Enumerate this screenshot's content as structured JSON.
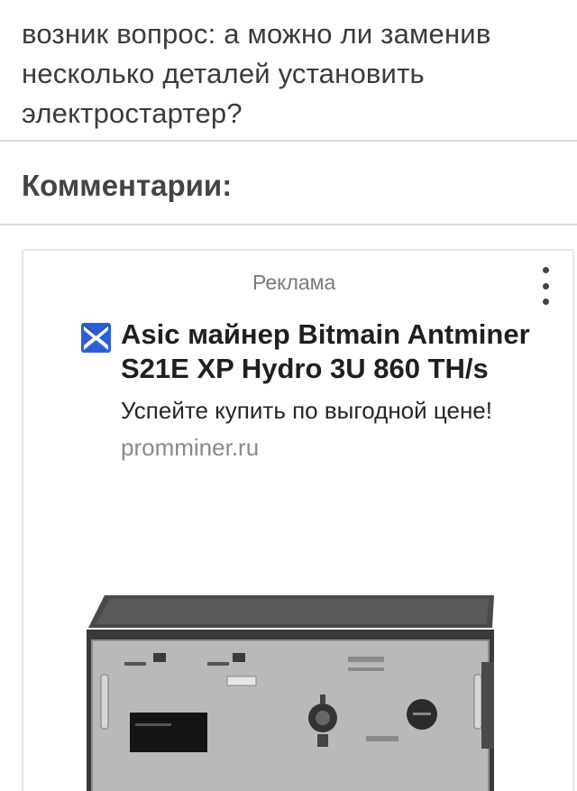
{
  "article": {
    "text_lines": [
      "возник вопрос: а можно ли заменив",
      "несколько деталей установить",
      "электростартер?"
    ]
  },
  "comments": {
    "heading": "Комментарии:"
  },
  "ad": {
    "label": "Реклама",
    "icon": "ad-network-x-icon",
    "title": "Asic майнер Bitmain Antminer S21E XP Hydro 3U 860 TH/s",
    "text": "Успейте купить по выгодной цене!",
    "domain": "promminer.ru",
    "menu_icon": "more-vertical-icon",
    "image": "asic-miner-product-photo"
  }
}
